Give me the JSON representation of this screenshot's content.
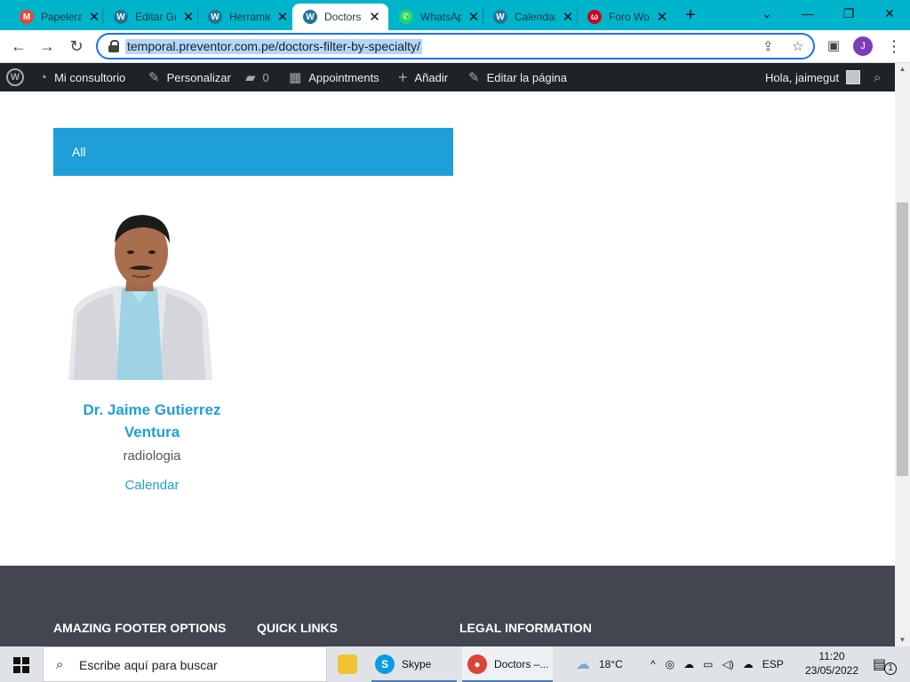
{
  "browser": {
    "tabs": [
      {
        "title": "Papelera",
        "icon": "gmail-icon",
        "color": "#ea4335",
        "active": false
      },
      {
        "title": "Editar Gr",
        "icon": "wordpress-icon",
        "color": "#21759b",
        "active": false
      },
      {
        "title": "Herramientas",
        "icon": "wordpress-icon",
        "color": "#21759b",
        "active": false
      },
      {
        "title": "Doctors",
        "icon": "wordpress-icon",
        "color": "#21759b",
        "active": true
      },
      {
        "title": "WhatsApp",
        "icon": "whatsapp-icon",
        "color": "#25d366",
        "active": false
      },
      {
        "title": "Calendario",
        "icon": "wordpress-icon",
        "color": "#21759b",
        "active": false
      },
      {
        "title": "Foro Wo",
        "icon": "foro-icon",
        "color": "#d0021b",
        "active": false
      }
    ],
    "url": "temporal.preventor.com.pe/doctors-filter-by-specialty/",
    "profile_initial": "J"
  },
  "wp_admin_bar": {
    "site": "Mi consultorio",
    "customize": "Personalizar",
    "comments_count": "0",
    "appointments": "Appointments",
    "add_new": "Añadir",
    "edit_page": "Editar la página",
    "greeting": "Hola, jaimegut"
  },
  "page": {
    "filter_label": "All",
    "doctor": {
      "name": "Dr. Jaime Gutierrez Ventura",
      "specialty": "radiologia",
      "link": "Calendar"
    },
    "footer_headings": [
      "AMAZING FOOTER OPTIONS",
      "QUICK LINKS",
      "LEGAL INFORMATION"
    ]
  },
  "taskbar": {
    "search_placeholder": "Escribe aquí para buscar",
    "apps": [
      {
        "label": "Skype"
      },
      {
        "label": "Doctors –..."
      }
    ],
    "weather": "18°C",
    "language": "ESP",
    "time": "11:20",
    "date": "23/05/2022",
    "notifications": "1"
  },
  "colors": {
    "accent": "#1e9fd9",
    "tabstrip": "#00b4cc",
    "wpbar": "#1d2327",
    "footer": "#434551"
  }
}
